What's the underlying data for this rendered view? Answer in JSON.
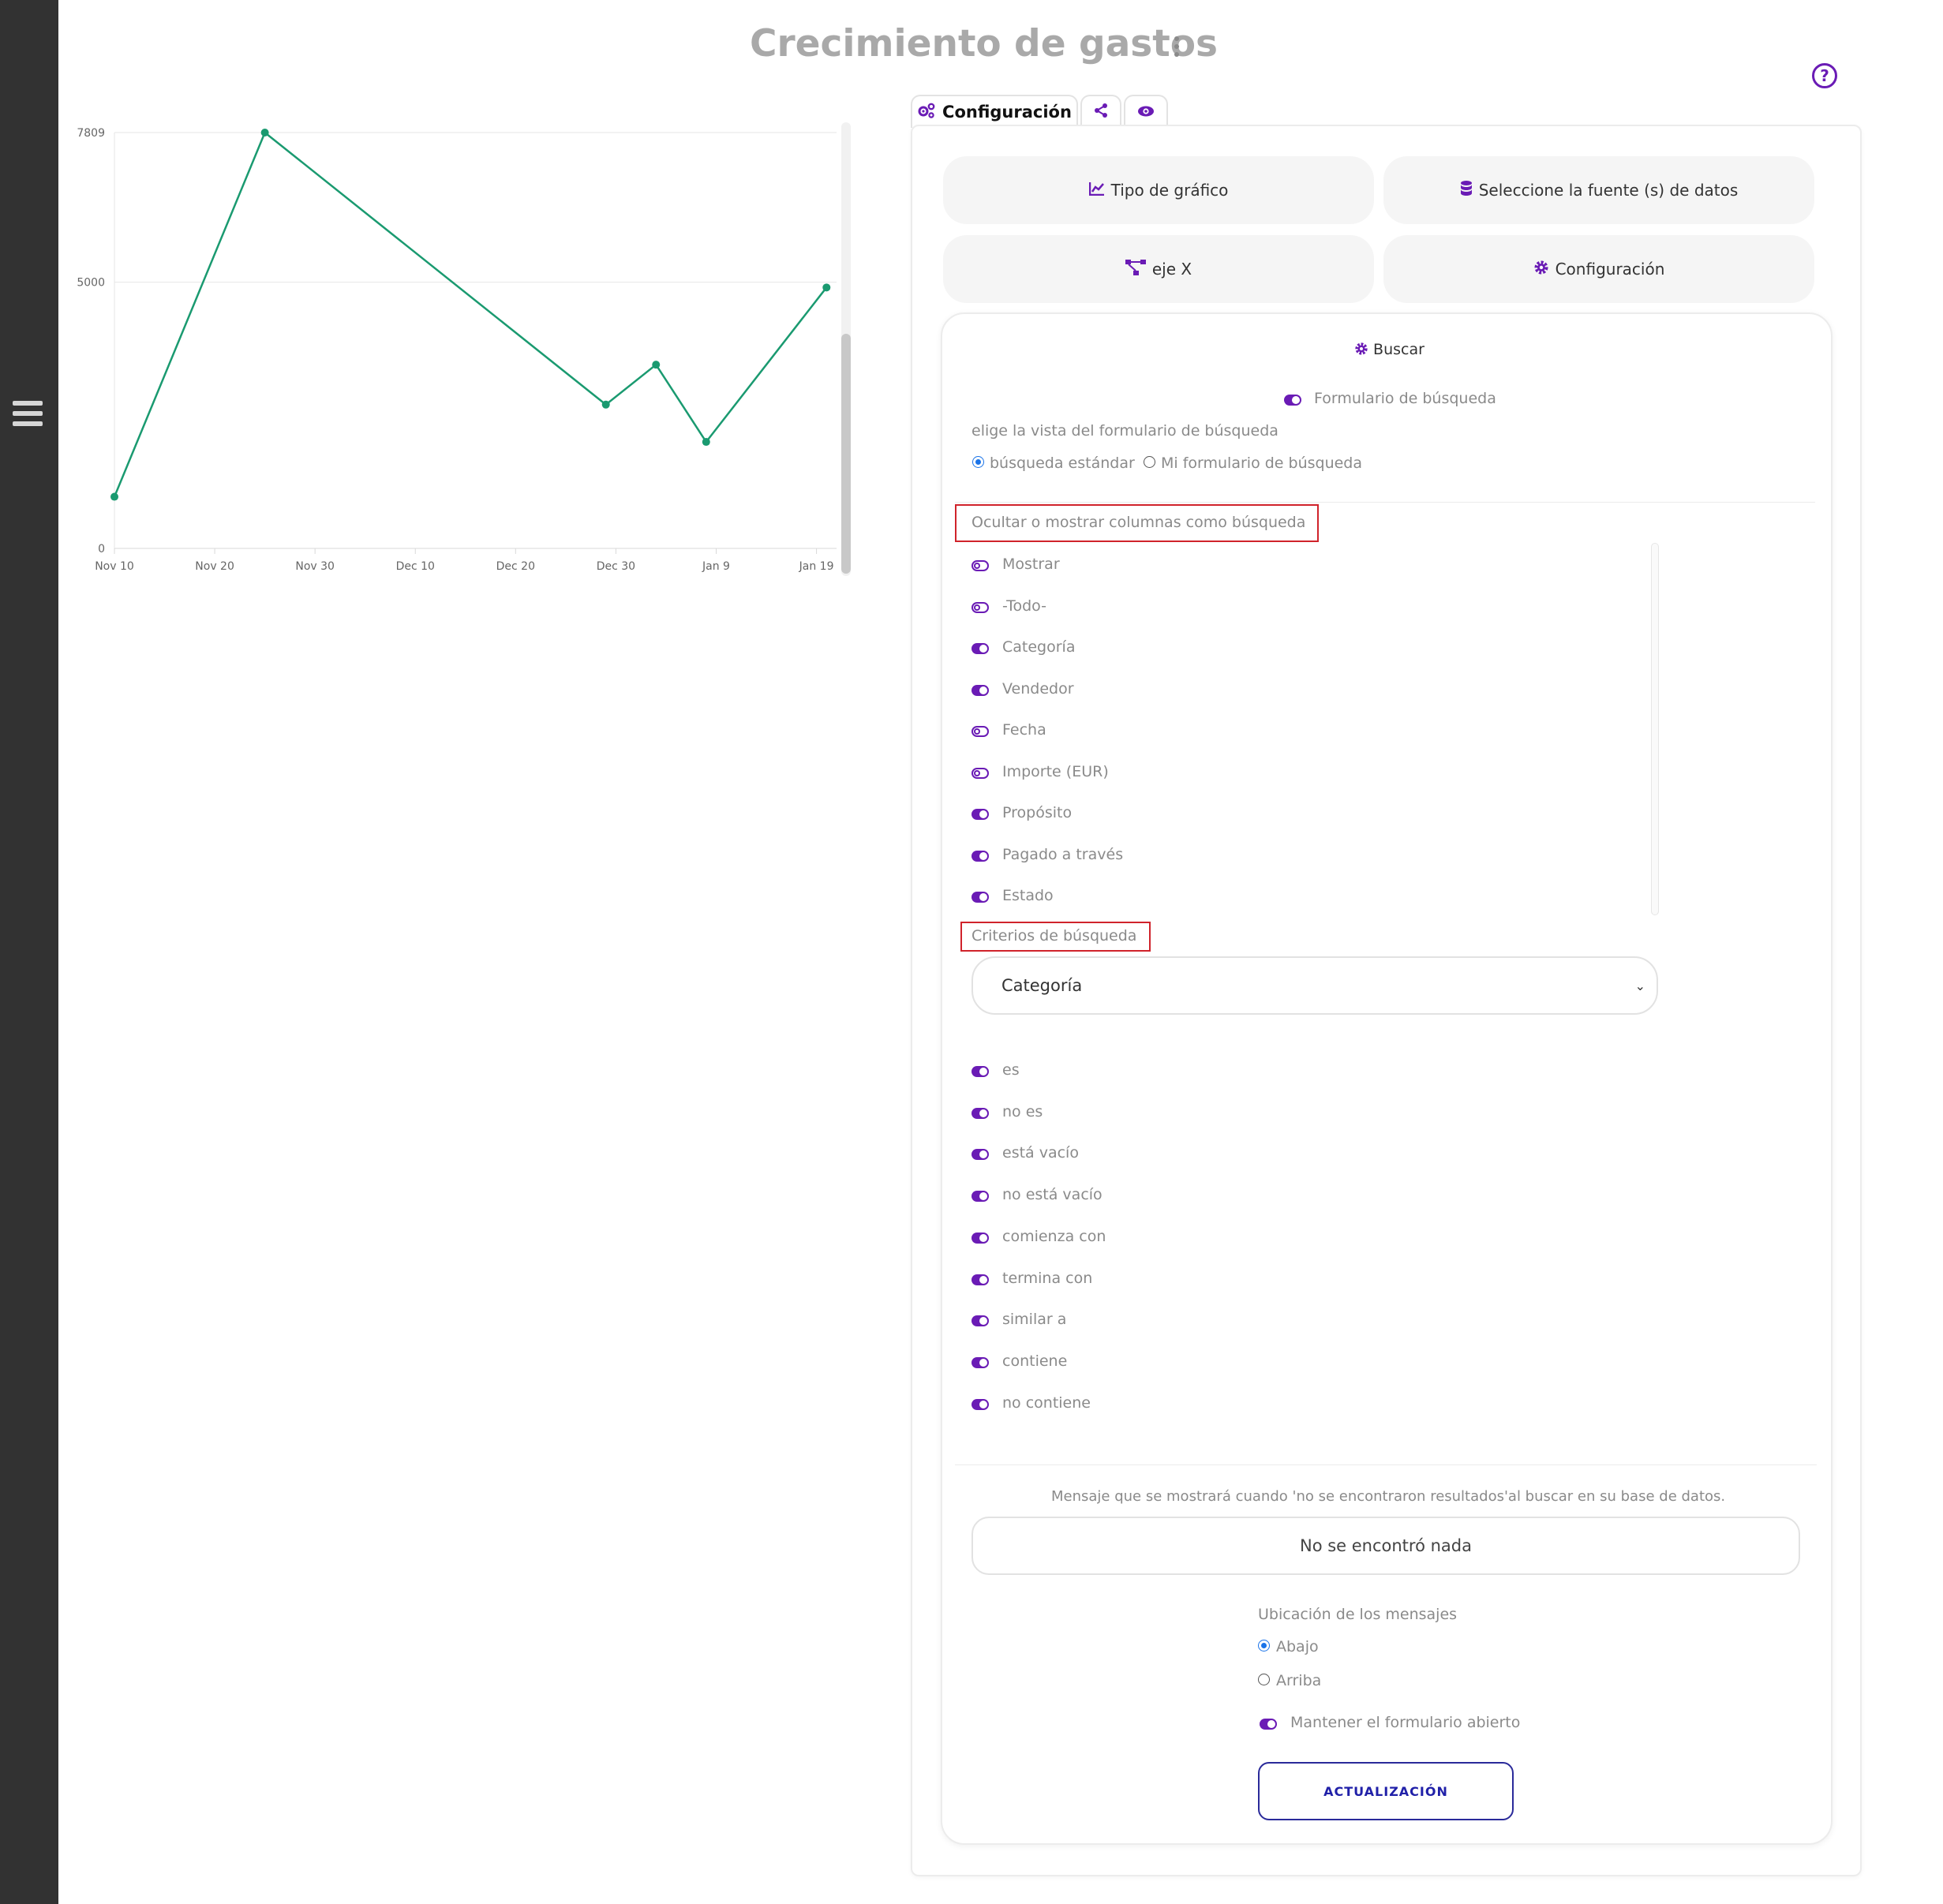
{
  "page": {
    "title": "Crecimiento de gastos"
  },
  "icons": {
    "hamburger": "hamburger-icon",
    "help": "help-icon",
    "kebab": "kebab-icon",
    "gears": "gears-icon",
    "share": "share-icon",
    "eye": "eye-icon",
    "chart": "line-chart-icon",
    "database": "database-icon",
    "nodes": "nodes-icon",
    "gear": "gear-icon"
  },
  "colors": {
    "accent": "#6a1bb5",
    "line": "#1a9a70",
    "sidebar": "#323232",
    "highlight": "#d0232b",
    "radio": "#1a73e8"
  },
  "chart_data": {
    "type": "line",
    "x": [
      "2023-11-10",
      "2023-11-25",
      "2023-12-29",
      "2024-01-03",
      "2024-01-08",
      "2024-01-20"
    ],
    "values": [
      970,
      7809,
      2700,
      3450,
      2000,
      4900
    ],
    "xticks": [
      "Nov 10",
      "Nov 20",
      "Nov 30",
      "Dec 10",
      "Dec 20",
      "Dec 30",
      "Jan 9",
      "Jan 19"
    ],
    "yticks": [
      "0",
      "5000",
      "7809"
    ],
    "ylim": [
      0,
      7809
    ],
    "grid": true,
    "legend": "none"
  },
  "tabs": {
    "config": "Configuración"
  },
  "tiles": {
    "chart_type": "Tipo de gráfico",
    "data_source": "Seleccione la fuente (s) de datos",
    "x_axis": "eje X",
    "settings": "Configuración"
  },
  "search": {
    "heading": "Buscar",
    "form_toggle_label": "Formulario de búsqueda",
    "form_toggle_on": true,
    "view_label": "elige la vista del formulario de búsqueda",
    "view_options": [
      "búsqueda estándar",
      "Mi formulario de búsqueda"
    ],
    "view_selected": "búsqueda estándar",
    "columns_label": "Ocultar o mostrar columnas como búsqueda",
    "columns": [
      {
        "label": "Mostrar",
        "on": false
      },
      {
        "label": "-Todo-",
        "on": false
      },
      {
        "label": "Categoría",
        "on": true
      },
      {
        "label": "Vendedor",
        "on": true
      },
      {
        "label": "Fecha",
        "on": false
      },
      {
        "label": "Importe (EUR)",
        "on": false
      },
      {
        "label": "Propósito",
        "on": true
      },
      {
        "label": "Pagado a través",
        "on": true
      },
      {
        "label": "Estado",
        "on": true
      }
    ],
    "criteria_label": "Criterios de búsqueda",
    "criteria_selected": "Categoría",
    "operators": [
      {
        "label": "es",
        "on": true
      },
      {
        "label": "no es",
        "on": true
      },
      {
        "label": "está vacío",
        "on": true
      },
      {
        "label": "no está vacío",
        "on": true
      },
      {
        "label": "comienza con",
        "on": true
      },
      {
        "label": "termina con",
        "on": true
      },
      {
        "label": "similar a",
        "on": true
      },
      {
        "label": "contiene",
        "on": true
      },
      {
        "label": "no contiene",
        "on": true
      }
    ],
    "no_results_label": "Mensaje que se mostrará cuando 'no se encontraron resultados'al buscar en su base de datos.",
    "no_results_value": "No se encontró nada",
    "location_label": "Ubicación de los mensajes",
    "location_options": [
      "Abajo",
      "Arriba"
    ],
    "location_selected": "Abajo",
    "keep_open_label": "Mantener el formulario abierto",
    "keep_open_on": true,
    "update_button": "ACTUALIZACIÓN"
  }
}
